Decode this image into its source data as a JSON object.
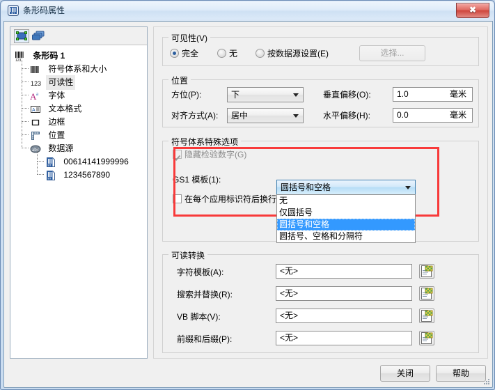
{
  "window": {
    "title": "条形码属性",
    "close_tooltip": "关闭",
    "icon": "barcode-properties-icon"
  },
  "sidebar": {
    "toolbar": [
      {
        "name": "select-object-icon",
        "selected": true
      },
      {
        "name": "layers-icon",
        "selected": false
      }
    ],
    "tree": [
      {
        "label": "条形码 1",
        "icon": "barcode-icon",
        "level": 0,
        "bold": true,
        "selected": false
      },
      {
        "label": "符号体系和大小",
        "icon": "symbology-icon",
        "level": 1,
        "selected": false
      },
      {
        "label": "可读性",
        "icon": "human-readable-icon",
        "level": 1,
        "selected": true
      },
      {
        "label": "字体",
        "icon": "font-icon",
        "level": 1,
        "selected": false
      },
      {
        "label": "文本格式",
        "icon": "text-format-icon",
        "level": 1,
        "selected": false
      },
      {
        "label": "边框",
        "icon": "border-icon",
        "level": 1,
        "selected": false
      },
      {
        "label": "位置",
        "icon": "position-icon",
        "level": 1,
        "selected": false
      },
      {
        "label": "数据源",
        "icon": "data-source-icon",
        "level": 1,
        "selected": false
      },
      {
        "label": "00614141999996",
        "icon": "data-record-icon",
        "level": 2,
        "selected": false
      },
      {
        "label": "1234567890",
        "icon": "data-record-icon",
        "level": 2,
        "selected": false
      }
    ]
  },
  "visibility": {
    "group_title": "可见性(V)",
    "options": [
      {
        "label": "完全",
        "checked": true
      },
      {
        "label": "无",
        "checked": false
      },
      {
        "label": "按数据源设置(E)",
        "checked": false
      }
    ],
    "select_button": "选择...",
    "select_button_enabled": false
  },
  "position": {
    "group_title": "位置",
    "orientation_label": "方位(P):",
    "orientation_value": "下",
    "alignment_label": "对齐方式(A):",
    "alignment_value": "居中",
    "vertical_offset_label": "垂直偏移(O):",
    "vertical_offset_value": "1.0",
    "vertical_offset_unit": "毫米",
    "horizontal_offset_label": "水平偏移(H):",
    "horizontal_offset_value": "0.0",
    "horizontal_offset_unit": "毫米"
  },
  "symbology_options": {
    "group_title": "符号体系特殊选项",
    "hide_check_digit_label": "隐藏检验数字(G)",
    "hide_check_digit_checked": true,
    "hide_check_digit_enabled": false,
    "gs1_template_label": "GS1 模板(1):",
    "gs1_template_value": "圆括号和空格",
    "gs1_template_options": [
      "无",
      "仅圆括号",
      "圆括号和空格",
      "圆括号、空格和分隔符"
    ],
    "gs1_template_selected_index": 2,
    "wrap_label": "在每个应用标识符后换行",
    "wrap_checked": false
  },
  "readable_conversion": {
    "group_title": "可读转换",
    "rows": [
      {
        "label": "字符模板(A):",
        "value": "<无>",
        "browse_icon": "browse-template-icon"
      },
      {
        "label": "搜索并替换(R):",
        "value": "<无>",
        "browse_icon": "browse-template-icon"
      },
      {
        "label": "VB 脚本(V):",
        "value": "<无>",
        "browse_icon": "browse-template-icon"
      },
      {
        "label": "前缀和后缀(P):",
        "value": "<无>",
        "browse_icon": "browse-template-icon"
      }
    ]
  },
  "footer": {
    "close_button": "关闭",
    "help_button": "帮助"
  },
  "colors": {
    "highlight_red": "#f83a3a",
    "selection_blue": "#3399ff",
    "titlebar_text": "#10293f"
  }
}
